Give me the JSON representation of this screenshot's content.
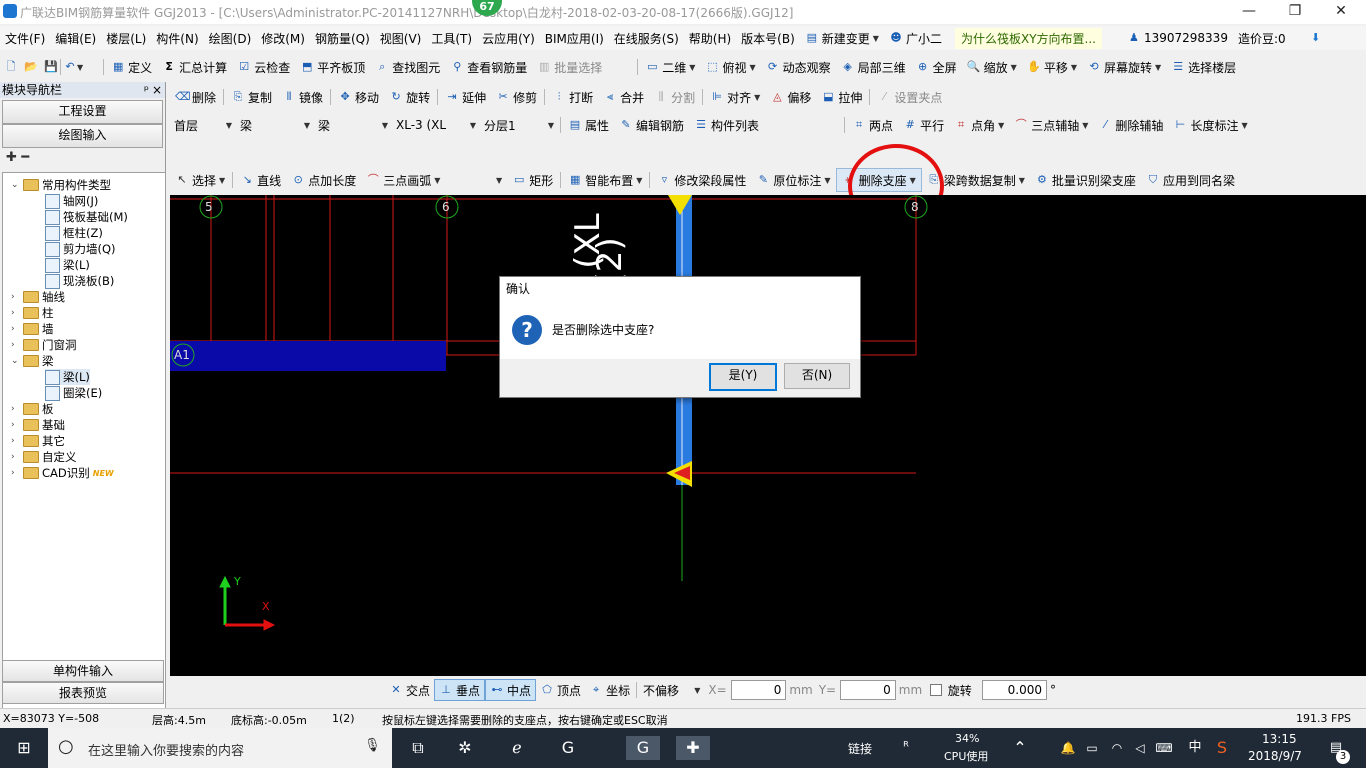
{
  "window": {
    "title": "广联达BIM钢筋算量软件 GGJ2013 - [C:\\Users\\Administrator.PC-20141127NRH\\Desktop\\白龙村-2018-02-03-20-08-17(2666版).GGJ12]",
    "badge": "67",
    "controls": [
      "—",
      "❐",
      "✕"
    ]
  },
  "menu": {
    "items": [
      "文件(F)",
      "编辑(E)",
      "楼层(L)",
      "构件(N)",
      "绘图(D)",
      "修改(M)",
      "钢筋量(Q)",
      "视图(V)",
      "工具(T)",
      "云应用(Y)",
      "BIM应用(I)",
      "在线服务(S)",
      "帮助(H)",
      "版本号(B)"
    ],
    "new_change": "新建变更",
    "assistant": "广小二",
    "hint": "为什么筏板XY方向布置...",
    "phone": "13907298339",
    "beans": "造价豆:0"
  },
  "toolbar1": [
    "定义",
    "汇总计算",
    "云检查",
    "平齐板顶",
    "查找图元",
    "查看钢筋量",
    "批量选择",
    "二维",
    "俯视",
    "动态观察",
    "局部三维",
    "全屏",
    "缩放",
    "平移",
    "屏幕旋转",
    "选择楼层"
  ],
  "toolbar2": [
    "删除",
    "复制",
    "镜像",
    "移动",
    "旋转",
    "延伸",
    "修剪",
    "打断",
    "合并",
    "分割",
    "对齐",
    "偏移",
    "拉伸",
    "设置夹点"
  ],
  "toolbar3": {
    "floor": "首层",
    "type1": "梁",
    "type2": "梁",
    "component": "XL-3 (XL",
    "layer": "分层1",
    "items": [
      "属性",
      "编辑钢筋",
      "构件列表",
      "两点",
      "平行",
      "点角",
      "三点辅轴",
      "删除辅轴",
      "长度标注"
    ]
  },
  "toolbar4": [
    "选择",
    "直线",
    "点加长度",
    "三点画弧",
    "矩形",
    "智能布置",
    "修改梁段属性",
    "原位标注",
    "删除支座",
    "梁跨数据复制",
    "批量识别梁支座",
    "应用到同名梁"
  ],
  "sidebar": {
    "title": "模块导航栏",
    "pin": "ᵖ",
    "close": "×",
    "btn_project": "工程设置",
    "btn_draw": "绘图输入",
    "btn_single": "单构件输入",
    "btn_report": "报表预览",
    "tree": [
      {
        "label": "常用构件类型",
        "level": 0,
        "toggle": "⌄",
        "folder": true
      },
      {
        "label": "轴网(J)",
        "level": 1
      },
      {
        "label": "筏板基础(M)",
        "level": 1
      },
      {
        "label": "框柱(Z)",
        "level": 1
      },
      {
        "label": "剪力墙(Q)",
        "level": 1
      },
      {
        "label": "梁(L)",
        "level": 1
      },
      {
        "label": "现浇板(B)",
        "level": 1
      },
      {
        "label": "轴线",
        "level": 0,
        "toggle": "›",
        "folder": true
      },
      {
        "label": "柱",
        "level": 0,
        "toggle": "›",
        "folder": true
      },
      {
        "label": "墙",
        "level": 0,
        "toggle": "›",
        "folder": true
      },
      {
        "label": "门窗洞",
        "level": 0,
        "toggle": "›",
        "folder": true
      },
      {
        "label": "梁",
        "level": 0,
        "toggle": "⌄",
        "folder": true
      },
      {
        "label": "梁(L)",
        "level": 1,
        "selected": true
      },
      {
        "label": "圈梁(E)",
        "level": 1
      },
      {
        "label": "板",
        "level": 0,
        "toggle": "›",
        "folder": true
      },
      {
        "label": "基础",
        "level": 0,
        "toggle": "›",
        "folder": true
      },
      {
        "label": "其它",
        "level": 0,
        "toggle": "›",
        "folder": true
      },
      {
        "label": "自定义",
        "level": 0,
        "toggle": "›",
        "folder": true
      },
      {
        "label": "CAD识别",
        "level": 0,
        "toggle": "›",
        "folder": true,
        "new": "NEW"
      }
    ]
  },
  "canvas": {
    "axis_labels": [
      "5",
      "6",
      "8",
      "A1"
    ],
    "beam_text_1": "(XL",
    "beam_text_2": "00(2)",
    "ucs_y": "Y",
    "ucs_x": "X"
  },
  "dialog": {
    "title": "确认",
    "message": "是否删除选中支座?",
    "yes": "是(Y)",
    "no": "否(N)"
  },
  "snap": {
    "items": [
      "交点",
      "垂点",
      "中点",
      "顶点",
      "坐标"
    ],
    "offset": "不偏移",
    "x_label": "X=",
    "x_value": "0",
    "unit": "mm",
    "y_label": "Y=",
    "y_value": "0",
    "rotate": "旋转",
    "rotate_value": "0.000",
    "degree": "°"
  },
  "status": {
    "coords": "X=83073 Y=-508",
    "floor_height": "层高:4.5m",
    "base_height": "底标高:-0.05m",
    "count": "1(2)",
    "hint": "按鼠标左键选择需要删除的支座点，按右键确定或ESC取消",
    "fps": "191.3 FPS"
  },
  "taskbar": {
    "search": "在这里输入你要搜索的内容",
    "link": "链接",
    "cpu_pct": "34%",
    "cpu_label": "CPU使用",
    "ime": "中",
    "time": "13:15",
    "date": "2018/9/7",
    "notif": "3"
  }
}
